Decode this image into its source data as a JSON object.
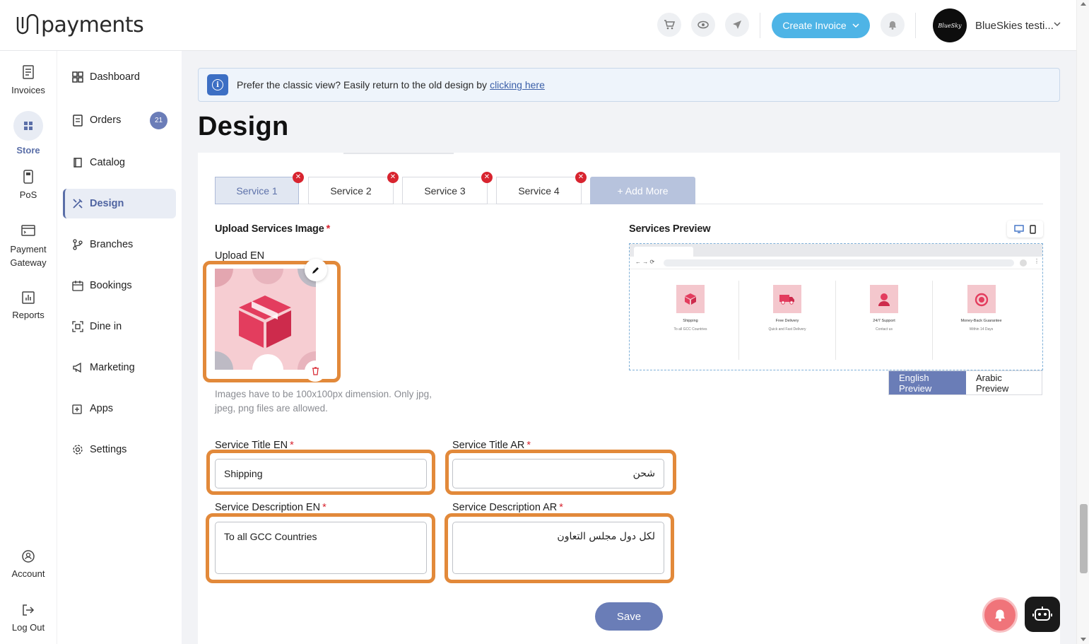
{
  "header": {
    "logo_text": "payments",
    "create_invoice": "Create Invoice",
    "store_name": "BlueSkies testi...",
    "avatar_text": "BlueSky"
  },
  "rail": {
    "items": [
      {
        "label": "Invoices",
        "icon": "invoice-icon"
      },
      {
        "label": "Store",
        "icon": "store-icon",
        "active": true
      },
      {
        "label": "PoS",
        "icon": "pos-icon"
      },
      {
        "label_line1": "Payment",
        "label_line2": "Gateway",
        "icon": "payment-gateway-icon"
      },
      {
        "label": "Reports",
        "icon": "reports-icon"
      },
      {
        "label": "Account",
        "icon": "account-icon"
      },
      {
        "label": "Log Out",
        "icon": "logout-icon"
      }
    ]
  },
  "subnav": {
    "items": [
      {
        "label": "Dashboard"
      },
      {
        "label": "Orders",
        "badge": "21"
      },
      {
        "label": "Catalog"
      },
      {
        "label": "Design",
        "active": true
      },
      {
        "label": "Branches"
      },
      {
        "label": "Bookings"
      },
      {
        "label": "Dine in"
      },
      {
        "label": "Marketing"
      },
      {
        "label": "Apps"
      },
      {
        "label": "Settings"
      }
    ]
  },
  "banner": {
    "text": "Prefer the classic view? Easily return to the old design by",
    "link": "clicking here"
  },
  "page_title": "Design",
  "tabs": [
    "Service 1",
    "Service 2",
    "Service 3",
    "Service 4"
  ],
  "add_more": "+ Add More",
  "upload": {
    "section_label": "Upload Services Image",
    "upload_en": "Upload EN",
    "hint": "Images have to be 100x100px dimension. Only jpg, jpeg, png files are allowed."
  },
  "form": {
    "title_en_label": "Service Title EN",
    "title_en_value": "Shipping",
    "title_ar_label": "Service Title AR",
    "title_ar_value": "شحن",
    "desc_en_label": "Service Description EN",
    "desc_en_value": "To all GCC Countries",
    "desc_ar_label": "Service Description AR",
    "desc_ar_value": "لكل دول مجلس التعاون",
    "required_mark": "*",
    "save": "Save"
  },
  "preview": {
    "label": "Services Preview",
    "columns": [
      {
        "title": "Shipping",
        "subtitle": "To all GCC Countries"
      },
      {
        "title": "Free Delivery",
        "subtitle": "Quick and Fast Delivery"
      },
      {
        "title": "24/7 Support",
        "subtitle": "Contact us"
      },
      {
        "title": "Money-Back Guarantee",
        "subtitle": "Within 14 Days"
      }
    ],
    "english_btn": "English Preview",
    "arabic_btn": "Arabic Preview"
  },
  "colors": {
    "accent": "#6a7db7",
    "highlight": "#e2893a",
    "primary_button": "#4eb4e6",
    "danger": "#d8242f"
  }
}
